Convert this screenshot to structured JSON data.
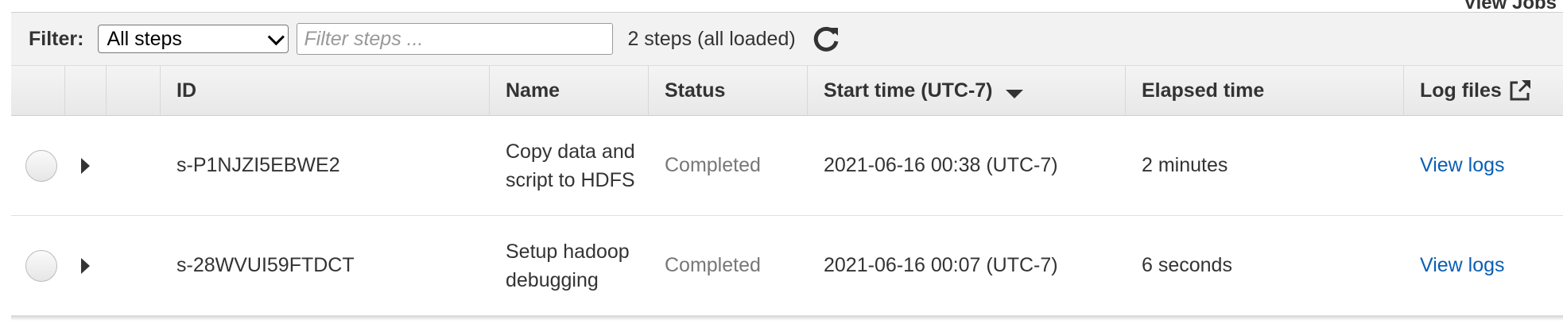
{
  "top_partial": "View Jobs",
  "filter": {
    "label": "Filter:",
    "select_value": "All steps",
    "input_placeholder": "Filter steps ...",
    "count_text": "2 steps (all loaded)"
  },
  "table": {
    "headers": {
      "id": "ID",
      "name": "Name",
      "status": "Status",
      "start_time": "Start time (UTC-7)",
      "elapsed": "Elapsed time",
      "log_files": "Log files"
    },
    "rows": [
      {
        "id": "s-P1NJZI5EBWE2",
        "name": "Copy data and script to HDFS",
        "status": "Completed",
        "start_time": "2021-06-16 00:38 (UTC-7)",
        "elapsed": "2 minutes",
        "log_link": "View logs"
      },
      {
        "id": "s-28WVUI59FTDCT",
        "name": "Setup hadoop debugging",
        "status": "Completed",
        "start_time": "2021-06-16 00:07 (UTC-7)",
        "elapsed": "6 seconds",
        "log_link": "View logs"
      }
    ]
  },
  "colors": {
    "link": "#0a5fb4",
    "status_text": "#777777",
    "header_bg": "#ececec"
  },
  "icons": {
    "refresh": "refresh-icon",
    "external_link": "external-link-icon",
    "sort": "sort-desc-icon",
    "expand": "expand-caret-icon"
  }
}
